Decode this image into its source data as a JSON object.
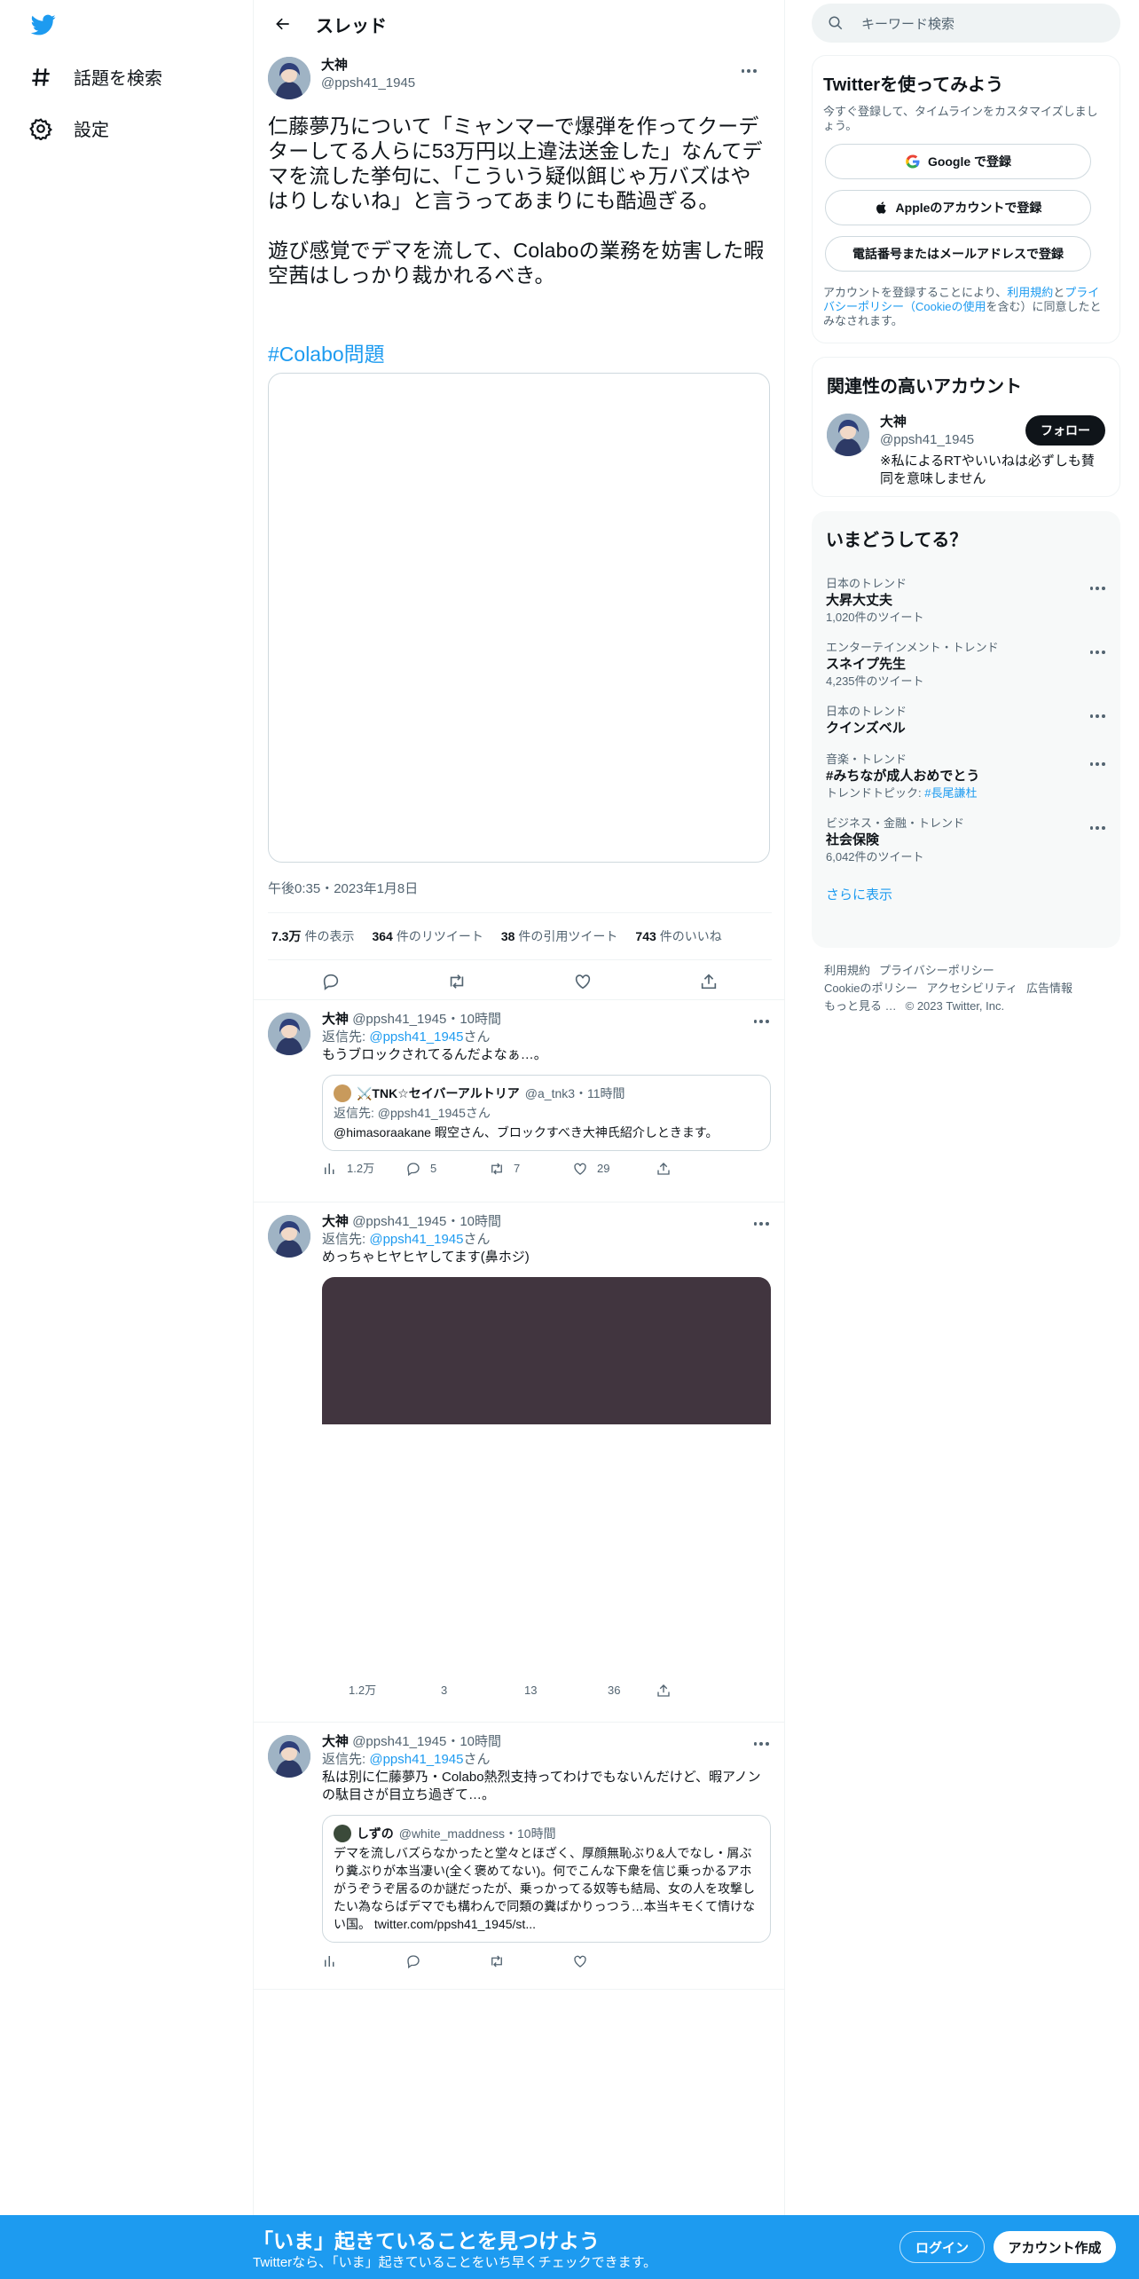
{
  "nav": {
    "explore": "話題を検索",
    "settings": "設定"
  },
  "header": {
    "title": "スレッド"
  },
  "focus": {
    "name": "大神",
    "handle": "@ppsh41_1945",
    "text": "仁藤夢乃について「ミャンマーで爆弾を作ってクーデターしてる人らに53万円以上違法送金した」なんてデマを流した挙句に、「こういう疑似餌じゃ万バズはやはりしないね」と言うってあまりにも酷過ぎる。\n\n遊び感覚でデマを流して、Colaboの業務を妨害した暇空茜はしっかり裁かれるべき。",
    "hashtag": "#Colabo問題",
    "time": "午後0:35・2023年1月8日",
    "views": "7.3万",
    "views_label": "件の表示",
    "retweets": "364",
    "retweets_label": "件のリツイート",
    "quotes": "38",
    "quotes_label": "件の引用ツイート",
    "likes": "743",
    "likes_label": "件のいいね"
  },
  "replies": [
    {
      "name": "大神",
      "meta": "@ppsh41_1945・10時間",
      "reply_prefix": "返信先: ",
      "reply_to": "@ppsh41_1945",
      "reply_suffix": "さん",
      "text": "もうブロックされてるんだよなぁ…。",
      "quote": {
        "name": "⚔️TNK☆セイバーアルトリア",
        "meta": "@a_tnk3・11時間",
        "reply": "返信先: @ppsh41_1945さん",
        "text": "@himasoraakane 暇空さん、ブロックすべき大神氏紹介しときます。"
      },
      "stats": {
        "views": "1.2万",
        "replies": "5",
        "retweets": "7",
        "likes": "29"
      }
    },
    {
      "name": "大神",
      "meta": "@ppsh41_1945・10時間",
      "reply_prefix": "返信先: ",
      "reply_to": "@ppsh41_1945",
      "reply_suffix": "さん",
      "text": "めっちゃヒヤヒヤしてます(鼻ホジ)",
      "stats": {
        "views": "1.2万",
        "replies": "3",
        "retweets": "13",
        "likes": "36"
      }
    },
    {
      "name": "大神",
      "meta": "@ppsh41_1945・10時間",
      "reply_prefix": "返信先: ",
      "reply_to": "@ppsh41_1945",
      "reply_suffix": "さん",
      "text": "私は別に仁藤夢乃・Colabo熱烈支持ってわけでもないんだけど、暇アノンの駄目さが目立ち過ぎて…。",
      "quote": {
        "name": "しずの",
        "meta": "@white_maddness・10時間",
        "text": "デマを流しバズらなかったと堂々とほざく、厚顔無恥ぶり&人でなし・屑ぶり糞ぶりが本当凄い(全く褒めてない)。何でこんな下衆を信じ乗っかるアホがうぞうぞ居るのか謎だったが、乗っかってる奴等も結局、女の人を攻撃したい為ならばデマでも構わんで同類の糞ばかりっつう…本当キモくて情けない国。 twitter.com/ppsh41_1945/st..."
      }
    }
  ],
  "search": {
    "placeholder": "キーワード検索"
  },
  "signup": {
    "title": "Twitterを使ってみよう",
    "sub": "今すぐ登録して、タイムラインをカスタマイズしましょう。",
    "google": "Google で登録",
    "apple": "Appleのアカウントで登録",
    "phone": "電話番号またはメールアドレスで登録",
    "legal_1": "アカウントを登録することにより、",
    "legal_terms": "利用規約",
    "legal_and": "と",
    "legal_privacy": "プライバシーポリシー",
    "legal_cookie": "（Cookieの使用",
    "legal_2": "を含む）に同意したとみなされます。"
  },
  "related": {
    "title": "関連性の高いアカウント",
    "name": "大神",
    "handle": "@ppsh41_1945",
    "bio": "※私によるRTやいいねは必ずしも賛同を意味しません",
    "follow": "フォロー"
  },
  "trends": {
    "title": "いまどうしてる？",
    "items": [
      {
        "cat": "日本のトレンド",
        "name": "大昇大丈夫",
        "count": "1,020件のツイート"
      },
      {
        "cat": "エンターテインメント・トレンド",
        "name": "スネイプ先生",
        "count": "4,235件のツイート"
      },
      {
        "cat": "日本のトレンド",
        "name": "クインズベル",
        "count": ""
      },
      {
        "cat": "音楽・トレンド",
        "name": "#みちなが成人おめでとう",
        "count": "トレンドトピック: ",
        "topic": "#長尾謙杜"
      },
      {
        "cat": "ビジネス・金融・トレンド",
        "name": "社会保険",
        "count": "6,042件のツイート"
      }
    ],
    "show_more": "さらに表示"
  },
  "footer": {
    "terms": "利用規約",
    "privacy": "プライバシーポリシー",
    "cookie": "Cookieのポリシー",
    "access": "アクセシビリティ",
    "ads": "広告情報",
    "more": "もっと見る …",
    "copy": "© 2023 Twitter, Inc."
  },
  "bottom": {
    "headline": "「いま」起きていることを見つけよう",
    "sub": "Twitterなら、「いま」起きていることをいち早くチェックできます。",
    "login": "ログイン",
    "signup": "アカウント作成"
  },
  "colors": {
    "accent": "#1d9bf0",
    "text": "#0f1419",
    "muted": "#536471"
  }
}
